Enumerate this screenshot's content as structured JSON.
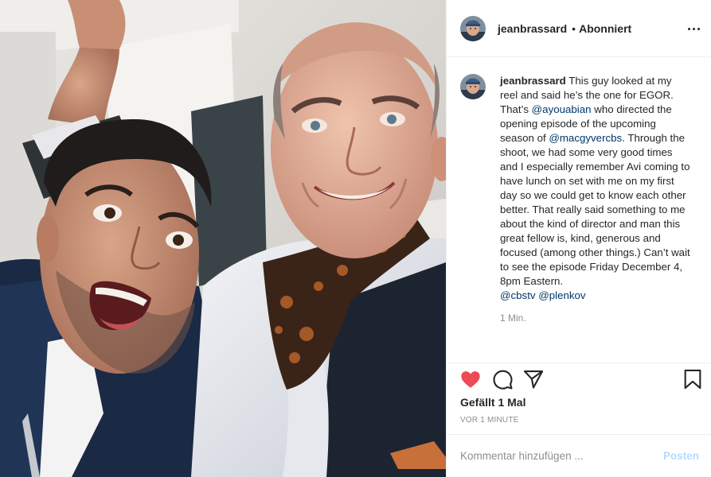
{
  "colors": {
    "like_red": "#ed4956",
    "mention_blue": "#00376b",
    "post_disabled": "#b3dbff",
    "muted_text": "#8e8e8e"
  },
  "post": {
    "photo_icon": "selfie-photo"
  },
  "header": {
    "username": "jeanbrassard",
    "separator": "•",
    "follow_label": "Abonniert",
    "more_icon": "more-horizontal-icon"
  },
  "caption": {
    "username": "jeanbrassard",
    "text_1": "This guy looked at my reel and said he’s the one for EGOR. That’s ",
    "mention_1": "@ayouabian",
    "text_2": " who directed the opening episode of the upcoming season of ",
    "mention_2": "@macgyvercbs",
    "text_3": ". Through the shoot, we had some very good times and I especially remember Avi coming to have lunch on set with me on my first day so we could get to know each other better. That really said something to me about the kind of director and man this great fellow is, kind, generous and focused (among other things.) Can’t wait to see the episode Friday December 4, 8pm Eastern.",
    "mention_3": "@cbstv",
    "mention_4": "@plenkov",
    "time": "1 Min."
  },
  "actions": {
    "like_icon": "heart-filled-icon",
    "comment_icon": "comment-icon",
    "share_icon": "share-icon",
    "save_icon": "bookmark-icon"
  },
  "likes": "Gefällt 1 Mal",
  "timestamp": "Vor 1 Minute",
  "composer": {
    "placeholder": "Kommentar hinzufügen ...",
    "post_label": "Posten"
  }
}
